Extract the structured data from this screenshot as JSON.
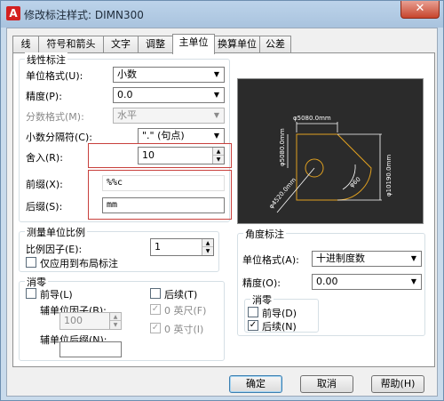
{
  "window": {
    "title": "修改标注样式: DIMN300",
    "close": "✕"
  },
  "tabs": [
    "线",
    "符号和箭头",
    "文字",
    "调整",
    "主单位",
    "换算单位",
    "公差"
  ],
  "linear": {
    "group_title": "线性标注",
    "unit_format_label": "单位格式(U):",
    "unit_format_value": "小数",
    "precision_label": "精度(P):",
    "precision_value": "0.0",
    "fraction_label": "分数格式(M):",
    "fraction_value": "水平",
    "decimal_sep_label": "小数分隔符(C):",
    "decimal_sep_value": "\".\"  (句点)",
    "roundoff_label": "舍入(R):",
    "roundoff_value": "10",
    "prefix_label": "前缀(X):",
    "prefix_value": "%%c",
    "suffix_label": "后缀(S):",
    "suffix_value": "mm"
  },
  "scale": {
    "group_title": "测量单位比例",
    "factor_label": "比例因子(E):",
    "factor_value": "1",
    "layout_only_label": "仅应用到布局标注"
  },
  "zero": {
    "group_title": "消零",
    "leading_label": "前导(L)",
    "sub_factor_label": "辅单位因子(B):",
    "sub_factor_value": "100",
    "sub_suffix_label": "辅单位后缀(N):",
    "sub_suffix_value": "",
    "trailing_label": "后续(T)",
    "feet_label": "0 英尺(F)",
    "inches_label": "0 英寸(I)"
  },
  "angular": {
    "group_title": "角度标注",
    "unit_format_label": "单位格式(A):",
    "unit_format_value": "十进制度数",
    "precision_label": "精度(O):",
    "precision_value": "0.00",
    "zero_title": "消零",
    "leading_label": "前导(D)",
    "trailing_label": "后续(N)"
  },
  "preview": {
    "dim_top": "φ5080.0mm",
    "dim_left": "φ5080.0mm",
    "dim_right": "φ10190.0mm",
    "dim_angle": "φ60",
    "dim_radius": "φ4520.0mm",
    "line_color": "#e0a020",
    "text_color": "#ffffff"
  },
  "buttons": {
    "ok": "确定",
    "cancel": "取消",
    "help": "帮助(H)"
  },
  "arrow": "▼",
  "spin_up": "▲",
  "spin_down": "▼",
  "checkmark": "✓"
}
